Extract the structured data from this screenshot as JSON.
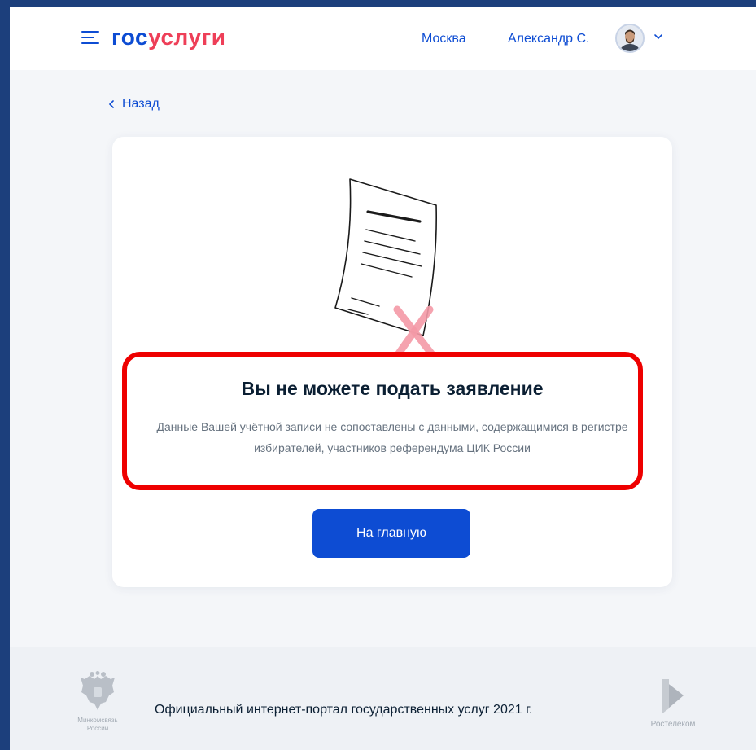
{
  "header": {
    "logo": {
      "part1": "гос",
      "part2": "услуги"
    },
    "city": "Москва",
    "user_name": "Александр С."
  },
  "nav": {
    "back_label": "Назад"
  },
  "card": {
    "title": "Вы не можете подать заявление",
    "description": "Данные Вашей учётной записи не сопоставлены с данными, содержащимися в регистре избирателей, участников референдума ЦИК России",
    "button_label": "На главную"
  },
  "footer": {
    "ministry_line1": "Минкомсвязь",
    "ministry_line2": "России",
    "portal_text": "Официальный интернет-портал государственных услуг 2021 г.",
    "partner": "Ростелеком"
  },
  "colors": {
    "brand_blue": "#0d4cd3",
    "brand_red": "#ee3f58",
    "highlight_red": "#ee0000",
    "outer_background": "#1c3f7c"
  },
  "icons": [
    "menu-icon",
    "avatar",
    "chevron-down-icon",
    "chevron-left-icon",
    "document-illustration",
    "cross-icon",
    "coat-of-arms-icon",
    "rostelecom-logo-icon"
  ]
}
